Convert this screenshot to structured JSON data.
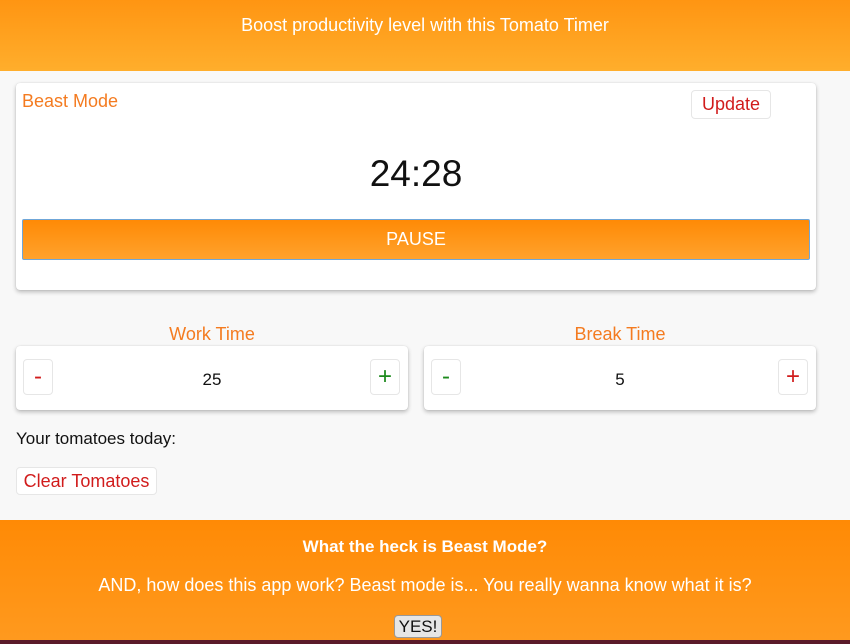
{
  "header": {
    "title": "Boost productivity level with this Tomato Timer"
  },
  "timer": {
    "mode_label": "Beast Mode",
    "update_label": "Update",
    "time": "24:28",
    "pause_label": "PAUSE"
  },
  "work": {
    "label": "Work Time",
    "value": "25",
    "minus": "-",
    "plus": "+"
  },
  "break": {
    "label": "Break Time",
    "value": "5",
    "minus": "-",
    "plus": "+"
  },
  "tomatoes": {
    "label": "Your tomatoes today:",
    "clear_label": "Clear Tomatoes"
  },
  "footer": {
    "title": "What the heck is Beast Mode?",
    "text": "AND, how does this app work? Beast mode is... You really wanna know what it is?",
    "yes_label": "YES!"
  },
  "colors": {
    "accent": "#ff9512",
    "label_orange": "#f47b20",
    "red": "#d11c1c",
    "green": "#1c8a1c"
  }
}
